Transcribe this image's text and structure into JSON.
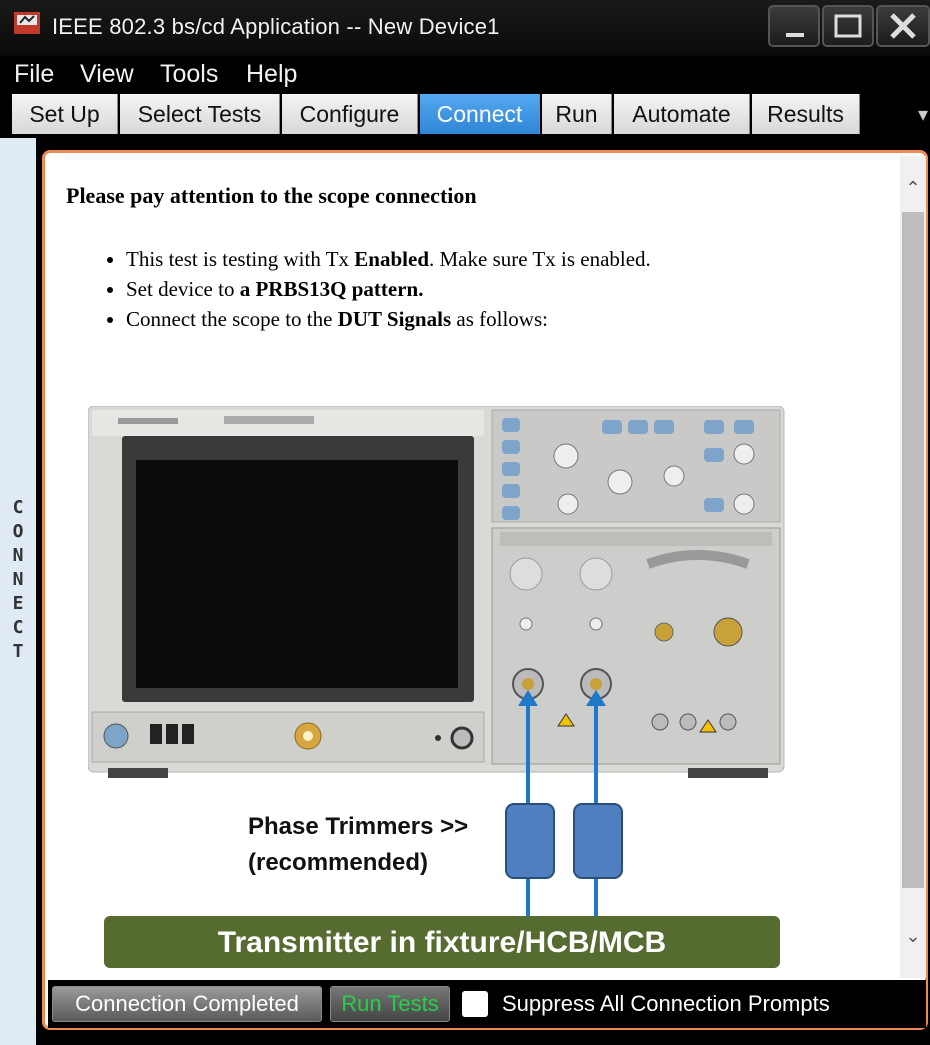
{
  "window": {
    "title": "IEEE 802.3 bs/cd Application -- New Device1",
    "controls": [
      "minimize-icon",
      "maximize-icon",
      "close-icon"
    ]
  },
  "menu": {
    "items": [
      "File",
      "View",
      "Tools",
      "Help"
    ]
  },
  "tabs": {
    "items": [
      "Set Up",
      "Select Tests",
      "Configure",
      "Connect",
      "Run",
      "Automate",
      "Results"
    ],
    "active": "Connect",
    "overflow_icon": "tab-overflow-icon"
  },
  "side_panel": {
    "label": "CONNECT"
  },
  "content": {
    "heading": "Please pay attention to the scope connection",
    "bullets": [
      {
        "pre": "This test is testing with Tx ",
        "bold": "Enabled",
        "post": ". Make sure Tx is enabled."
      },
      {
        "pre": "Set device to ",
        "bold": "a PRBS13Q pattern.",
        "post": ""
      },
      {
        "pre": "Connect the scope to the ",
        "bold": "DUT Signals",
        "post": " as follows:"
      }
    ],
    "figure": {
      "phase_trimmers_line1": "Phase Trimmers >>",
      "phase_trimmers_line2": "(recommended)",
      "transmitter_label": "Transmitter in fixture/HCB/MCB"
    }
  },
  "footer": {
    "connection_completed": "Connection Completed",
    "run_tests": "Run Tests",
    "suppress_label": "Suppress All Connection Prompts",
    "suppress_checked": false
  },
  "colors": {
    "active_tab": "#2f85d6",
    "frame_border": "#f08a55",
    "banner_green": "#556b2f",
    "cable_blue": "#1f78c8",
    "trimmer_blue": "#4f7fbf",
    "run_tests_text": "#25d04a"
  }
}
